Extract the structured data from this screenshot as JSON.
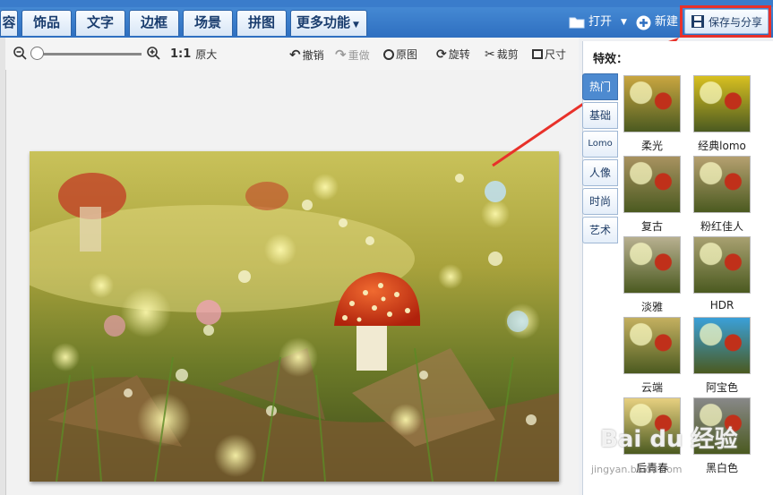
{
  "tabs": [
    "容",
    "饰品",
    "文字",
    "边框",
    "场景",
    "拼图",
    "更多功能"
  ],
  "header": {
    "open_label": "打开",
    "new_label": "新建",
    "save_label": "保存与分享"
  },
  "toolbar": {
    "ratio_label": "1:1",
    "original_size_label": "原大",
    "undo_label": "撤销",
    "redo_label": "重做",
    "original_label": "原图",
    "rotate_label": "旋转",
    "crop_label": "裁剪",
    "size_label": "尺寸"
  },
  "effects": {
    "title": "特效：",
    "categories": [
      "热门",
      "基础",
      "Lomo",
      "人像",
      "时尚",
      "艺术"
    ],
    "active_category": "热门",
    "items": [
      {
        "label": "柔光",
        "tint": "#c9a640"
      },
      {
        "label": "经典lomo",
        "tint": "#d8c020"
      },
      {
        "label": "复古",
        "tint": "#a89260"
      },
      {
        "label": "粉红佳人",
        "tint": "#b5a070"
      },
      {
        "label": "淡雅",
        "tint": "#b8b090"
      },
      {
        "label": "HDR",
        "tint": "#a8a070"
      },
      {
        "label": "云端",
        "tint": "#c4b060"
      },
      {
        "label": "阿宝色",
        "tint": "#3aa0d8"
      },
      {
        "label": "后青春",
        "tint": "#e7d080"
      },
      {
        "label": "黑白色",
        "tint": "#888888"
      }
    ]
  },
  "watermark": {
    "text": "Bai du 经验",
    "url": "jingyan.baidu.com"
  },
  "colors": {
    "accent": "#3a7ccb",
    "highlight": "#e8312a"
  }
}
